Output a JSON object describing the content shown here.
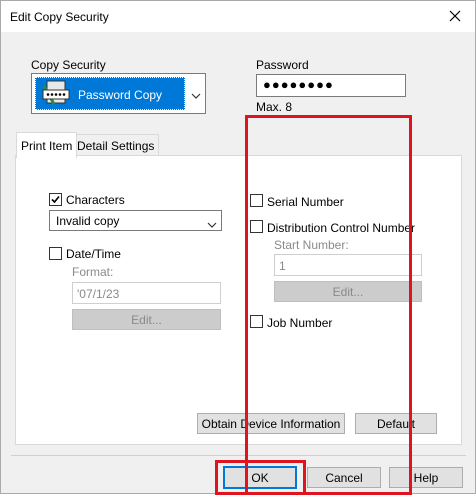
{
  "window": {
    "title": "Edit Copy Security"
  },
  "copy_security": {
    "label": "Copy Security",
    "selected": "Password Copy",
    "icon": "password-copy-icon"
  },
  "password": {
    "label": "Password",
    "value": "●●●●●●●●",
    "hint": "Max. 8"
  },
  "tabs": [
    {
      "label": "Print Item",
      "active": true
    },
    {
      "label": "Detail Settings",
      "active": false
    }
  ],
  "left": {
    "characters_label": "Characters",
    "characters_checked": true,
    "characters_value": "Invalid copy",
    "datetime_label": "Date/Time",
    "datetime_checked": false,
    "format_label": "Format:",
    "format_value": "'07/1/23",
    "edit_label": "Edit..."
  },
  "right": {
    "serial_label": "Serial Number",
    "distribution_label": "Distribution Control Number",
    "start_label": "Start Number:",
    "start_value": "1",
    "edit_label": "Edit...",
    "job_label": "Job Number"
  },
  "buttons": {
    "obtain": "Obtain Device Information",
    "default": "Default",
    "ok": "OK",
    "cancel": "Cancel",
    "help": "Help"
  },
  "colors": {
    "accent": "#0078d7",
    "highlight": "#e0141e"
  }
}
